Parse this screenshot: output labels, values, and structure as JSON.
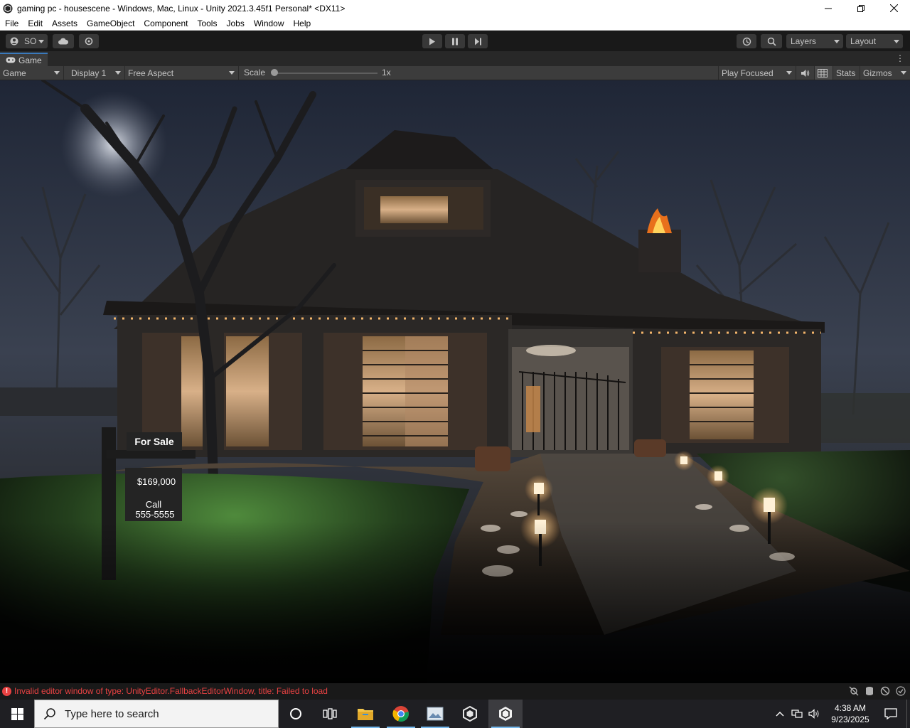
{
  "window": {
    "title": "gaming pc - housescene - Windows, Mac, Linux - Unity 2021.3.45f1 Personal* <DX11>"
  },
  "menu": [
    "File",
    "Edit",
    "Assets",
    "GameObject",
    "Component",
    "Tools",
    "Jobs",
    "Window",
    "Help"
  ],
  "toolbar": {
    "account_label": "SO",
    "layers_label": "Layers",
    "layout_label": "Layout"
  },
  "game_tab": {
    "title": "Game"
  },
  "game_toolbar": {
    "mode": "Game",
    "display": "Display 1",
    "aspect": "Free Aspect",
    "scale_label": "Scale",
    "scale_value": "1x",
    "scale_fraction": 0.0,
    "play_mode": "Play Focused",
    "stats_label": "Stats",
    "gizmos_label": "Gizmos"
  },
  "scene": {
    "sign_for_sale": "For Sale",
    "sign_price": "$169,000",
    "sign_call": "Call",
    "sign_phone": "555-5555"
  },
  "status": {
    "message": "Invalid editor window of type: UnityEditor.FallbackEditorWindow, title: Failed to load"
  },
  "taskbar": {
    "search_placeholder": "Type here to search",
    "time": "4:38 AM",
    "date": "9/23/2025"
  },
  "colors": {
    "accent_tab": "#3a79bb",
    "error_red": "#e84242",
    "taskbar_bg": "#1f1f23"
  }
}
